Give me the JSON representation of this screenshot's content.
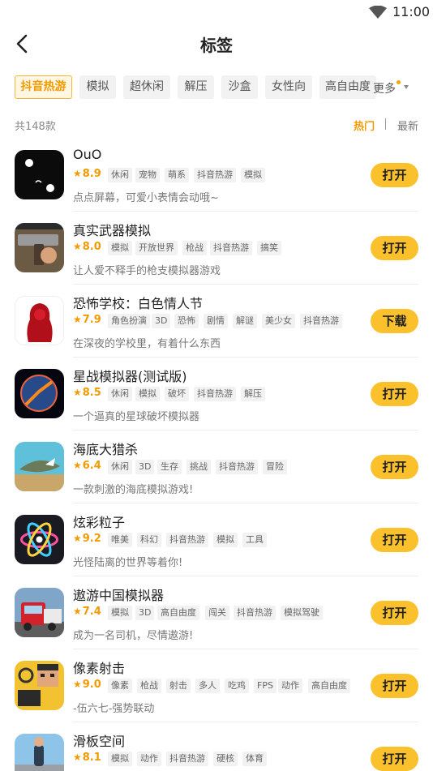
{
  "status": {
    "time": "11:00"
  },
  "header": {
    "title": "标签"
  },
  "tags": [
    "抖音热游",
    "模拟",
    "超休闲",
    "解压",
    "沙盒",
    "女性向",
    "高自由度"
  ],
  "more_label": "更多",
  "count_label": "共148款",
  "sort": {
    "hot": "热门",
    "new": "最新"
  },
  "games": [
    {
      "name": "OuO",
      "rating": "8.9",
      "tags": [
        "休闲",
        "宠物",
        "萌系",
        "抖音热游",
        "模拟"
      ],
      "desc": "点点屏幕，可爱小表情会动哦~",
      "button": "打开"
    },
    {
      "name": "真实武器模拟",
      "rating": "8.0",
      "tags": [
        "模拟",
        "开放世界",
        "枪战",
        "抖音热游",
        "搞笑"
      ],
      "desc": "让人爱不释手的枪支模拟器游戏",
      "button": "打开"
    },
    {
      "name": "恐怖学校：白色情人节",
      "rating": "7.9",
      "tags": [
        "角色扮演",
        "3D",
        "恐怖",
        "剧情",
        "解谜",
        "美少女",
        "抖音热游"
      ],
      "desc": "在深夜的学校里，有着什么东西",
      "button": "下载"
    },
    {
      "name": "星战模拟器(测试版)",
      "rating": "8.5",
      "tags": [
        "休闲",
        "模拟",
        "破坏",
        "抖音热游",
        "解压"
      ],
      "desc": "一个逼真的星球破坏模拟器",
      "button": "打开"
    },
    {
      "name": "海底大猎杀",
      "rating": "6.4",
      "tags": [
        "休闲",
        "3D",
        "生存",
        "挑战",
        "抖音热游",
        "冒险"
      ],
      "desc": "一款刺激的海底模拟游戏!",
      "button": "打开"
    },
    {
      "name": "炫彩粒子",
      "rating": "9.2",
      "tags": [
        "唯美",
        "科幻",
        "抖音热游",
        "模拟",
        "工具"
      ],
      "desc": "光怪陆离的世界等着你!",
      "button": "打开"
    },
    {
      "name": "遨游中国模拟器",
      "rating": "7.4",
      "tags": [
        "模拟",
        "3D",
        "高自由度",
        "闯关",
        "抖音热游",
        "模拟驾驶"
      ],
      "desc": "成为一名司机，尽情遨游!",
      "button": "打开"
    },
    {
      "name": "像素射击",
      "rating": "9.0",
      "tags": [
        "像素",
        "枪战",
        "射击",
        "多人",
        "吃鸡",
        "FPS",
        "动作",
        "高自由度"
      ],
      "desc": "-伍六七-强势联动",
      "button": "打开"
    },
    {
      "name": "滑板空间",
      "rating": "8.1",
      "tags": [
        "模拟",
        "动作",
        "抖音热游",
        "硬核",
        "体育"
      ],
      "desc": "",
      "button": "打开"
    }
  ]
}
